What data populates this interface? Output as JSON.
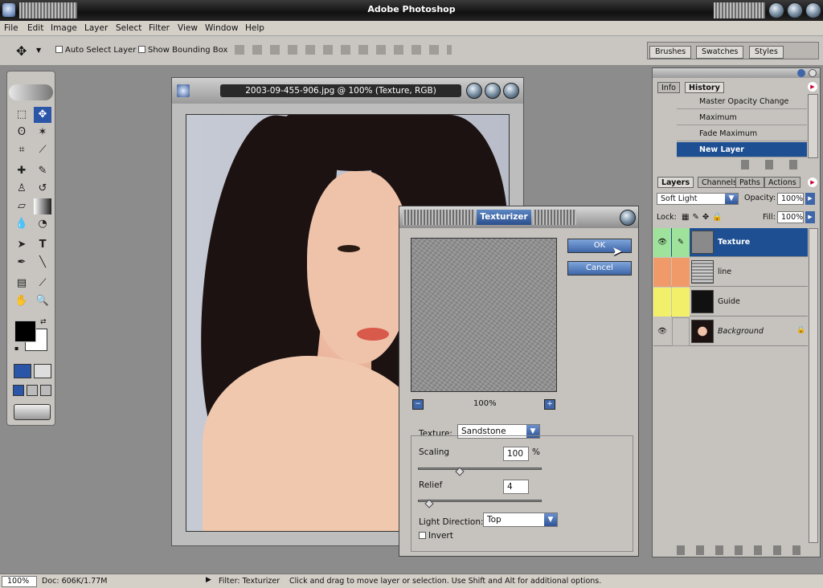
{
  "app": {
    "title": "Adobe Photoshop"
  },
  "menu": [
    "File",
    "Edit",
    "Image",
    "Layer",
    "Select",
    "Filter",
    "View",
    "Window",
    "Help"
  ],
  "options": {
    "auto_select_label": "Auto Select Layer",
    "bounding_box_label": "Show Bounding Box"
  },
  "wells": [
    "Brushes",
    "Swatches",
    "Styles"
  ],
  "document": {
    "title": "2003-09-455-906.jpg @ 100% (Texture, RGB)"
  },
  "texturizer": {
    "title": "Texturizer",
    "ok_label": "OK",
    "cancel_label": "Cancel",
    "zoom": "100%",
    "texture_label": "Texture:",
    "texture_value": "Sandstone",
    "scaling_label": "Scaling",
    "scaling_value": "100",
    "scaling_unit": "%",
    "relief_label": "Relief",
    "relief_value": "4",
    "light_label": "Light Direction:",
    "light_value": "Top",
    "invert_label": "Invert"
  },
  "history": {
    "tabs": [
      "Info",
      "History"
    ],
    "items": [
      "Master Opacity Change",
      "Maximum",
      "Fade Maximum",
      "New Layer"
    ]
  },
  "layers": {
    "tabs": [
      "Layers",
      "Channels",
      "Paths",
      "Actions"
    ],
    "blend_mode": "Soft Light",
    "opacity_label": "Opacity:",
    "opacity_value": "100%",
    "lock_label": "Lock:",
    "fill_label": "Fill:",
    "fill_value": "100%",
    "items": [
      "Texture",
      "line",
      "Guide",
      "Background"
    ],
    "colors": [
      "#9ee29b",
      "#f09a6a",
      "#f2f06a",
      "#c6c3be"
    ]
  },
  "status": {
    "zoom": "100%",
    "doc": "Doc: 606K/1.77M",
    "filter": "Filter: Texturizer",
    "hint": "Click and drag to move layer or selection.  Use Shift and Alt for additional options."
  }
}
